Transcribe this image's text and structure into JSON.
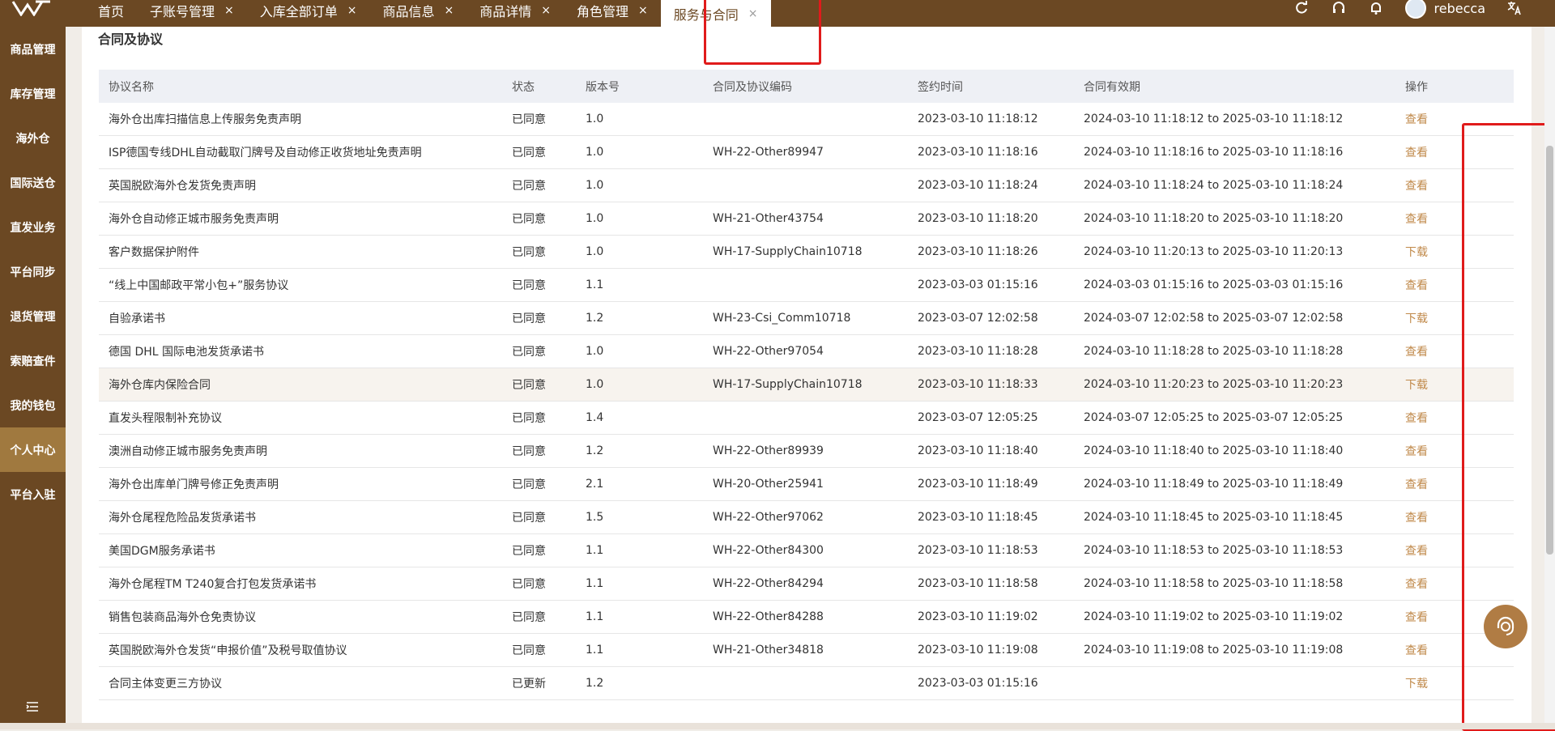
{
  "tabs": [
    {
      "label": "首页",
      "closable": false
    },
    {
      "label": "子账号管理",
      "closable": true
    },
    {
      "label": "入库全部订单",
      "closable": true
    },
    {
      "label": "商品信息",
      "closable": true
    },
    {
      "label": "商品详情",
      "closable": true
    },
    {
      "label": "角色管理",
      "closable": true
    },
    {
      "label": "服务与合同",
      "closable": true,
      "active": true
    }
  ],
  "close_glyph": "×",
  "user": {
    "name": "rebecca"
  },
  "icons": {
    "refresh": "refresh-icon",
    "headset": "headset-icon",
    "bell": "bell-icon",
    "translate": "translate-icon"
  },
  "sidebar": {
    "items": [
      {
        "label": "商品管理"
      },
      {
        "label": "库存管理"
      },
      {
        "label": "海外仓"
      },
      {
        "label": "国际送仓"
      },
      {
        "label": "直发业务"
      },
      {
        "label": "平台同步"
      },
      {
        "label": "退货管理"
      },
      {
        "label": "索赔查件"
      },
      {
        "label": "我的钱包"
      },
      {
        "label": "个人中心",
        "active": true
      },
      {
        "label": "平台入驻"
      }
    ]
  },
  "page": {
    "title": "合同及协议"
  },
  "table": {
    "headers": [
      "协议名称",
      "状态",
      "版本号",
      "合同及协议编码",
      "签约时间",
      "合同有效期",
      "操作"
    ],
    "rows": [
      {
        "name": "海外仓出库扫描信息上传服务免责声明",
        "status": "已同意",
        "version": "1.0",
        "code": "",
        "signed": "2023-03-10 11:18:12",
        "validity": "2024-03-10 11:18:12 to 2025-03-10 11:18:12",
        "action": "查看"
      },
      {
        "name": "ISP德国专线DHL自动截取门牌号及自动修正收货地址免责声明",
        "status": "已同意",
        "version": "1.0",
        "code": "WH-22-Other89947",
        "signed": "2023-03-10 11:18:16",
        "validity": "2024-03-10 11:18:16 to 2025-03-10 11:18:16",
        "action": "查看"
      },
      {
        "name": "英国脱欧海外仓发货免责声明",
        "status": "已同意",
        "version": "1.0",
        "code": "",
        "signed": "2023-03-10 11:18:24",
        "validity": "2024-03-10 11:18:24 to 2025-03-10 11:18:24",
        "action": "查看"
      },
      {
        "name": "海外仓自动修正城市服务免责声明",
        "status": "已同意",
        "version": "1.0",
        "code": "WH-21-Other43754",
        "signed": "2023-03-10 11:18:20",
        "validity": "2024-03-10 11:18:20 to 2025-03-10 11:18:20",
        "action": "查看"
      },
      {
        "name": "客户数据保护附件",
        "status": "已同意",
        "version": "1.0",
        "code": "WH-17-SupplyChain10718",
        "signed": "2023-03-10 11:18:26",
        "validity": "2024-03-10 11:20:13 to 2025-03-10 11:20:13",
        "action": "下载"
      },
      {
        "name": "“线上中国邮政平常小包+”服务协议",
        "status": "已同意",
        "version": "1.1",
        "code": "",
        "signed": "2023-03-03 01:15:16",
        "validity": "2024-03-03 01:15:16 to 2025-03-03 01:15:16",
        "action": "查看"
      },
      {
        "name": "自验承诺书",
        "status": "已同意",
        "version": "1.2",
        "code": "WH-23-Csi_Comm10718",
        "signed": "2023-03-07 12:02:58",
        "validity": "2024-03-07 12:02:58 to 2025-03-07 12:02:58",
        "action": "下载"
      },
      {
        "name": "德国 DHL 国际电池发货承诺书",
        "status": "已同意",
        "version": "1.0",
        "code": "WH-22-Other97054",
        "signed": "2023-03-10 11:18:28",
        "validity": "2024-03-10 11:18:28 to 2025-03-10 11:18:28",
        "action": "查看"
      },
      {
        "name": "海外仓库内保险合同",
        "status": "已同意",
        "version": "1.0",
        "code": "WH-17-SupplyChain10718",
        "signed": "2023-03-10 11:18:33",
        "validity": "2024-03-10 11:20:23 to 2025-03-10 11:20:23",
        "action": "下载",
        "highlighted": true
      },
      {
        "name": "直发头程限制补充协议",
        "status": "已同意",
        "version": "1.4",
        "code": "",
        "signed": "2023-03-07 12:05:25",
        "validity": "2024-03-07 12:05:25 to 2025-03-07 12:05:25",
        "action": "查看"
      },
      {
        "name": "澳洲自动修正城市服务免责声明",
        "status": "已同意",
        "version": "1.2",
        "code": "WH-22-Other89939",
        "signed": "2023-03-10 11:18:40",
        "validity": "2024-03-10 11:18:40 to 2025-03-10 11:18:40",
        "action": "查看"
      },
      {
        "name": "海外仓出库单门牌号修正免责声明",
        "status": "已同意",
        "version": "2.1",
        "code": "WH-20-Other25941",
        "signed": "2023-03-10 11:18:49",
        "validity": "2024-03-10 11:18:49 to 2025-03-10 11:18:49",
        "action": "查看"
      },
      {
        "name": "海外仓尾程危险品发货承诺书",
        "status": "已同意",
        "version": "1.5",
        "code": "WH-22-Other97062",
        "signed": "2023-03-10 11:18:45",
        "validity": "2024-03-10 11:18:45 to 2025-03-10 11:18:45",
        "action": "查看"
      },
      {
        "name": "美国DGM服务承诺书",
        "status": "已同意",
        "version": "1.1",
        "code": "WH-22-Other84300",
        "signed": "2023-03-10 11:18:53",
        "validity": "2024-03-10 11:18:53 to 2025-03-10 11:18:53",
        "action": "查看"
      },
      {
        "name": "海外仓尾程TM T240复合打包发货承诺书",
        "status": "已同意",
        "version": "1.1",
        "code": "WH-22-Other84294",
        "signed": "2023-03-10 11:18:58",
        "validity": "2024-03-10 11:18:58 to 2025-03-10 11:18:58",
        "action": "查看"
      },
      {
        "name": "销售包装商品海外仓免责协议",
        "status": "已同意",
        "version": "1.1",
        "code": "WH-22-Other84288",
        "signed": "2023-03-10 11:19:02",
        "validity": "2024-03-10 11:19:02 to 2025-03-10 11:19:02",
        "action": "查看"
      },
      {
        "name": "英国脱欧海外仓发货“申报价值”及税号取值协议",
        "status": "已同意",
        "version": "1.1",
        "code": "WH-21-Other34818",
        "signed": "2023-03-10 11:19:08",
        "validity": "2024-03-10 11:19:08 to 2025-03-10 11:19:08",
        "action": "查看"
      },
      {
        "name": "合同主体变更三方协议",
        "status": "已更新",
        "version": "1.2",
        "code": "",
        "signed": "2023-03-03 01:15:16",
        "validity": "",
        "action": "下载"
      }
    ]
  },
  "colors": {
    "brand": "#6b4823",
    "sidebar_active": "#a0793f",
    "action_link": "#c0894a",
    "annotation_box": "#e01b1b"
  }
}
